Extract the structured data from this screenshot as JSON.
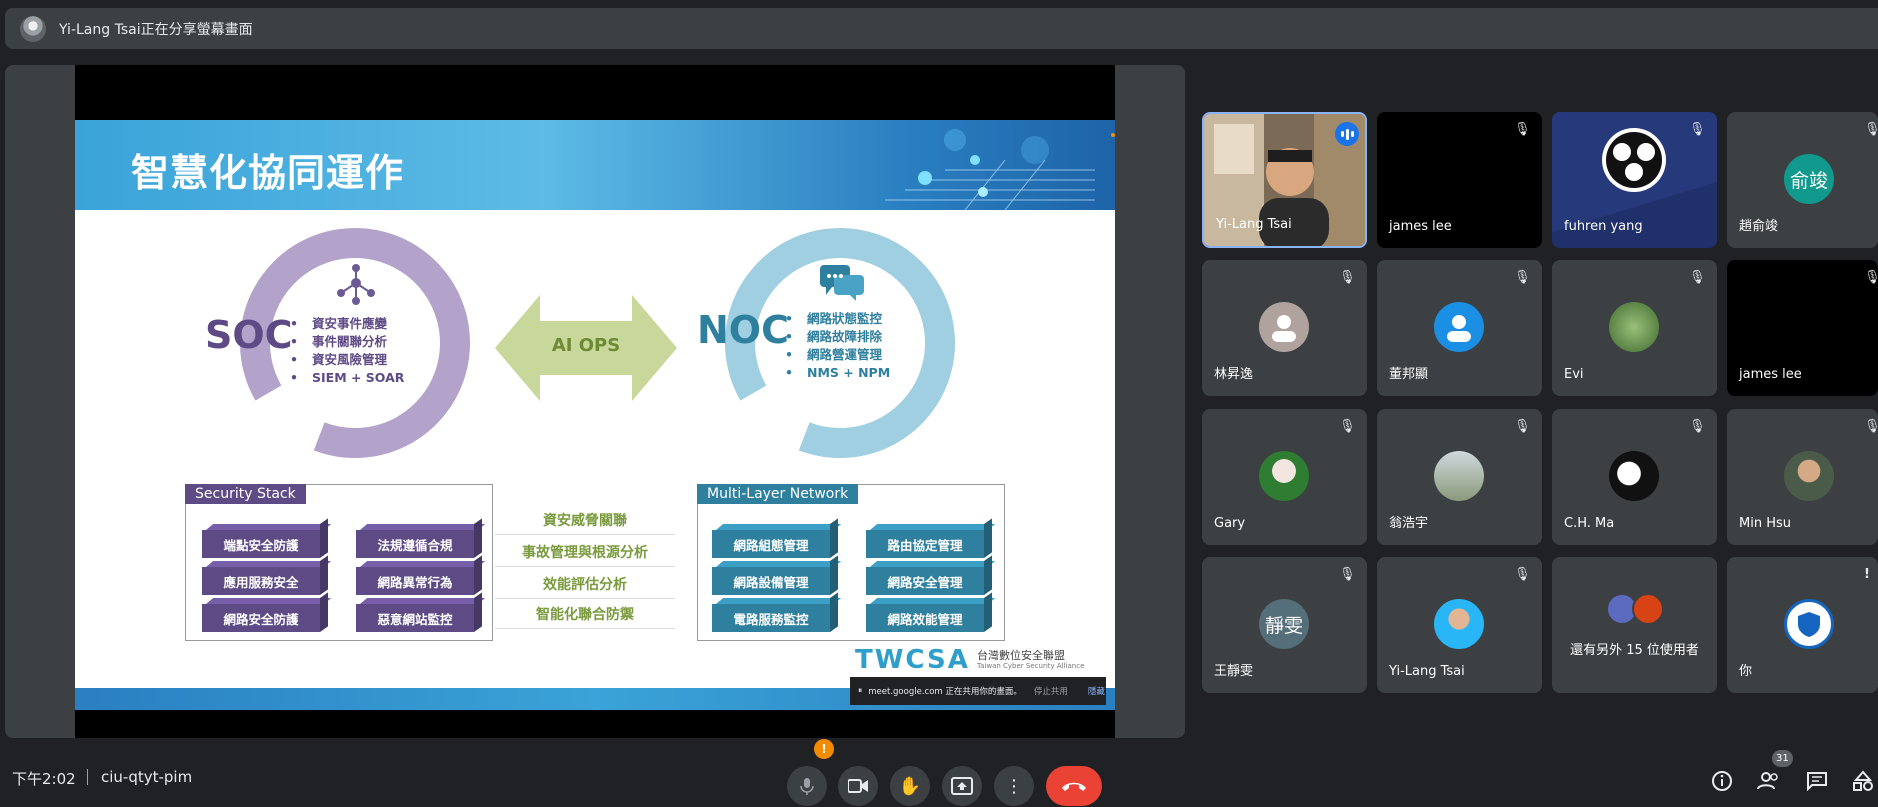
{
  "presenter": {
    "text": "Yi-Lang Tsai正在分享螢幕畫面"
  },
  "slide": {
    "title": "智慧化協同運作",
    "soc": {
      "label": "SOC",
      "items": [
        "資安事件應變",
        "事件關聯分析",
        "資安風險管理",
        "SIEM + SOAR"
      ]
    },
    "aiops": "AI OPS",
    "noc": {
      "label": "NOC",
      "items": [
        "網路狀態監控",
        "網路故障排除",
        "網路營運管理",
        "NMS + NPM"
      ]
    },
    "security_stack": {
      "label": "Security Stack",
      "blocks": [
        "端點安全防護",
        "法規遵循合規",
        "應用服務安全",
        "網路異常行為",
        "網路安全防護",
        "惡意網站監控"
      ]
    },
    "middle": [
      "資安威脅關聯",
      "事故管理與根源分析",
      "效能評估分析",
      "智能化聯合防禦"
    ],
    "network": {
      "label": "Multi-Layer Network",
      "blocks": [
        "網路組態管理",
        "路由協定管理",
        "網路設備管理",
        "網路安全管理",
        "電路服務監控",
        "網路效能管理"
      ]
    },
    "logo": {
      "text": "TWCSA",
      "cn": "台灣數位安全聯盟",
      "en": "Taiwan Cyber Security Alliance"
    }
  },
  "share_banner": {
    "text": "meet.google.com 正在共用你的畫面。",
    "stop": "停止共用",
    "hide": "隱藏"
  },
  "participants": [
    {
      "name": "Yi-Lang Tsai"
    },
    {
      "name": "james lee"
    },
    {
      "name": "fuhren yang"
    },
    {
      "name": "趙俞竣",
      "initials": "俞竣"
    },
    {
      "name": "林昇逸"
    },
    {
      "name": "董邦顯"
    },
    {
      "name": "Evi"
    },
    {
      "name": "james lee"
    },
    {
      "name": "Gary"
    },
    {
      "name": "翁浩宇"
    },
    {
      "name": "C.H. Ma"
    },
    {
      "name": "Min Hsu"
    },
    {
      "name": "王靜雯",
      "initials": "靜雯"
    },
    {
      "name": "Yi-Lang Tsai"
    },
    {
      "name": "還有另外 15 位使用者"
    },
    {
      "name": "你"
    }
  ],
  "bottom": {
    "time": "下午2:02",
    "meeting_code": "ciu-qtyt-pim",
    "people_count": "31",
    "warning": "!"
  },
  "colors": {
    "soc": "#b3a2c9",
    "noc": "#9fcfe0",
    "stack": "#5e4b86",
    "network": "#2f7f9e",
    "aiops": "#c7d89a",
    "end_call": "#ea4335"
  }
}
